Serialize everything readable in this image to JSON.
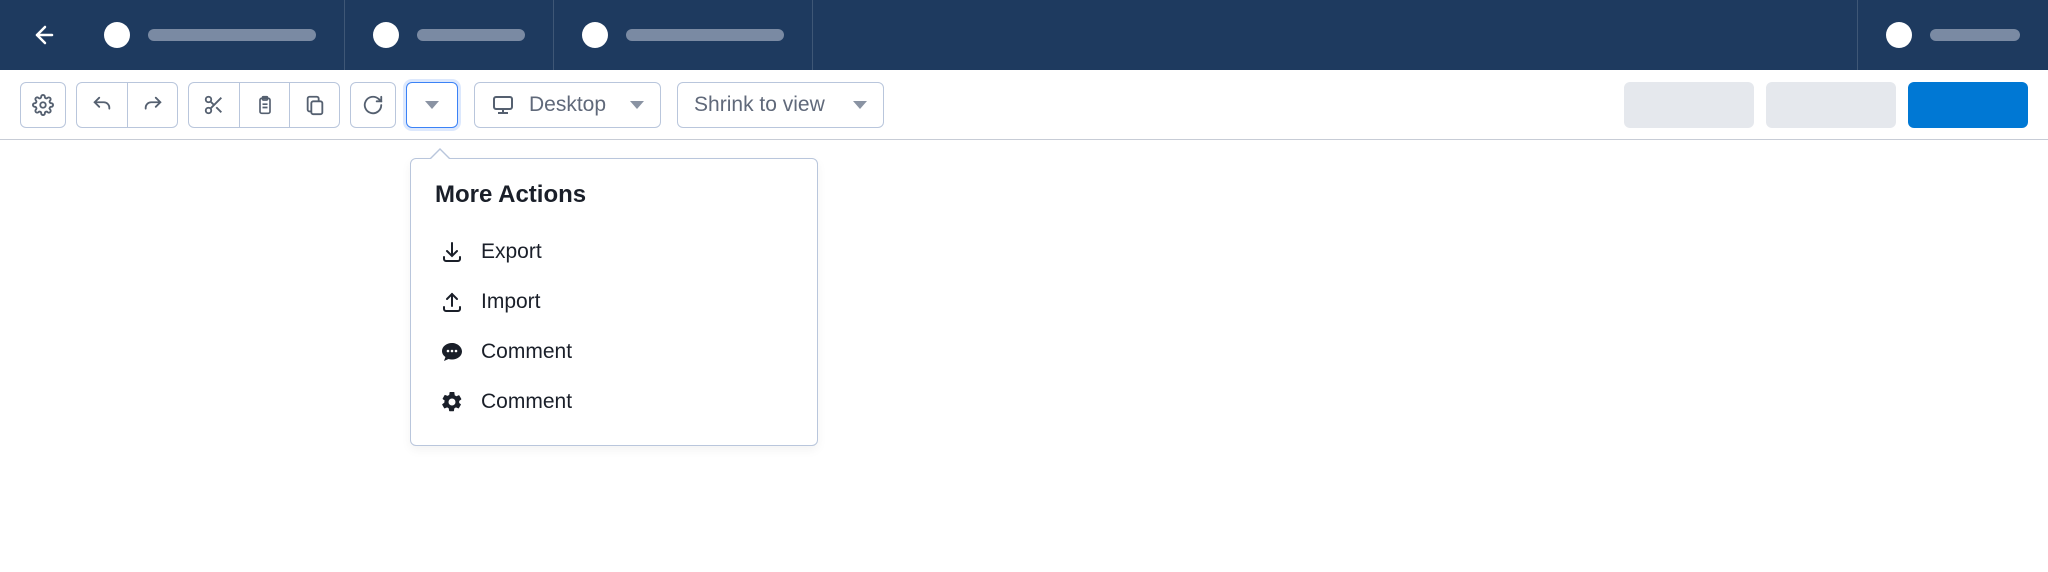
{
  "topbar": {
    "tabs": [
      {
        "placeholder_width": 168
      },
      {
        "placeholder_width": 108
      },
      {
        "placeholder_width": 158
      }
    ]
  },
  "toolbar": {
    "device_select": {
      "label": "Desktop"
    },
    "zoom_select": {
      "label": "Shrink to view"
    }
  },
  "popover": {
    "title": "More Actions",
    "items": [
      {
        "icon": "download",
        "label": "Export"
      },
      {
        "icon": "upload",
        "label": "Import"
      },
      {
        "icon": "comment",
        "label": "Comment"
      },
      {
        "icon": "gear",
        "label": "Comment"
      }
    ]
  }
}
